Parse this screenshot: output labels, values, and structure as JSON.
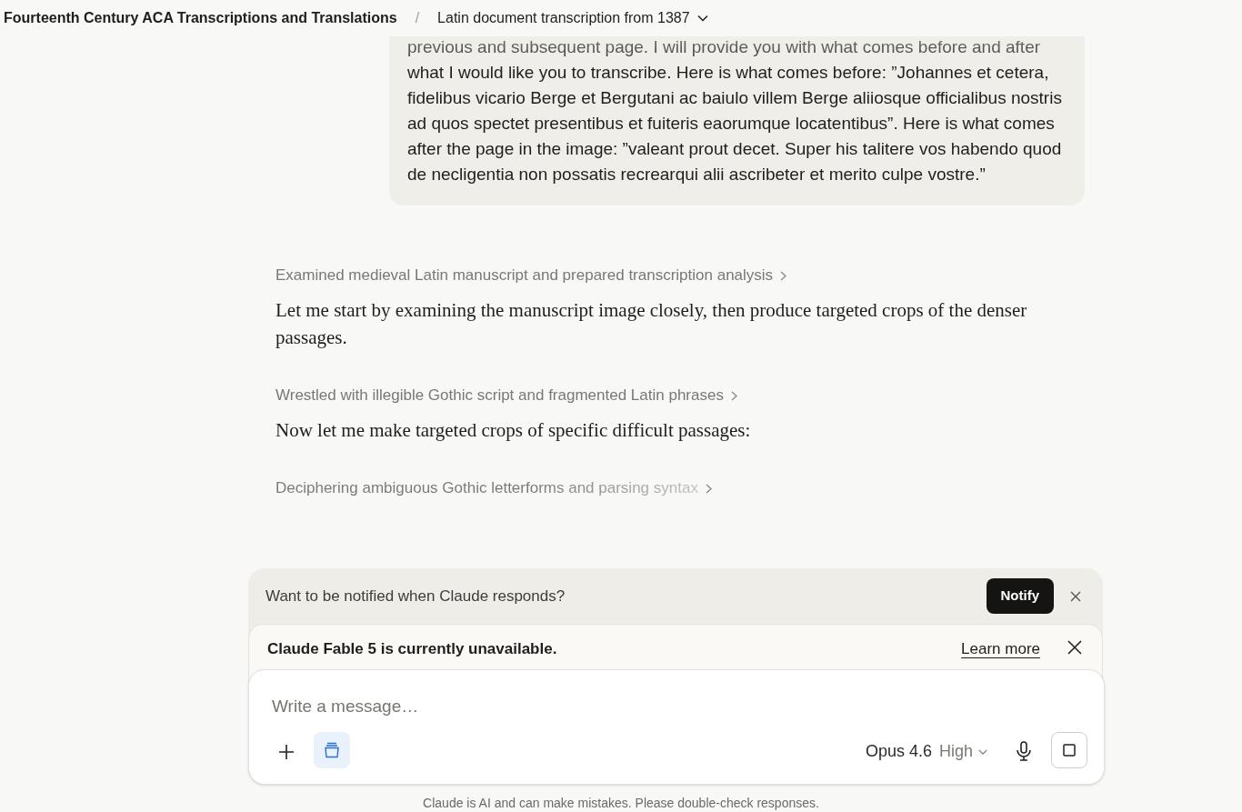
{
  "header": {
    "project": "Fourteenth Century ACA Transcriptions and Translations",
    "separator": "/",
    "chat_title": "Latin document transcription from 1387"
  },
  "user_message": {
    "text": "previous and subsequent page. I will provide you with what comes before and after what I would like you to transcribe. Here is what comes before: ”Johannes et cetera, fidelibus vicario Berge et Bergutani ac baiulo villem Berge aliiosque officialibus nostris ad quos spectet presentibus et fuiteris eaorumque locatentibus”. Here is what comes after the page in the image: ”valeant prout decet. Super his talitere vos habendo quod de necligentia non possatis recrearqui alii ascribeter et merito culpe vostre.”"
  },
  "assistant": [
    {
      "kind": "step",
      "label": "Examined medieval Latin manuscript and prepared transcription analysis",
      "in_progress": false
    },
    {
      "kind": "text",
      "text": "Let me start by examining the manuscript image closely, then produce targeted crops of the denser passages."
    },
    {
      "kind": "step",
      "label": "Wrestled with illegible Gothic script and fragmented Latin phrases",
      "in_progress": false
    },
    {
      "kind": "text",
      "text": "Now let me make targeted crops of specific difficult passages:"
    },
    {
      "kind": "step",
      "label": "Deciphering ambiguous Gothic letterforms and parsing syntax",
      "in_progress": true
    }
  ],
  "notify_banner": {
    "text": "Want to be notified when Claude responds?",
    "button": "Notify"
  },
  "unavailable_banner": {
    "text": "Claude Fable 5 is currently unavailable.",
    "link": "Learn more"
  },
  "composer": {
    "placeholder": "Write a message…",
    "model": "Opus 4.6",
    "effort": "High",
    "tool_active": true
  },
  "footer": "Claude is AI and can make mistakes. Please double-check responses."
}
